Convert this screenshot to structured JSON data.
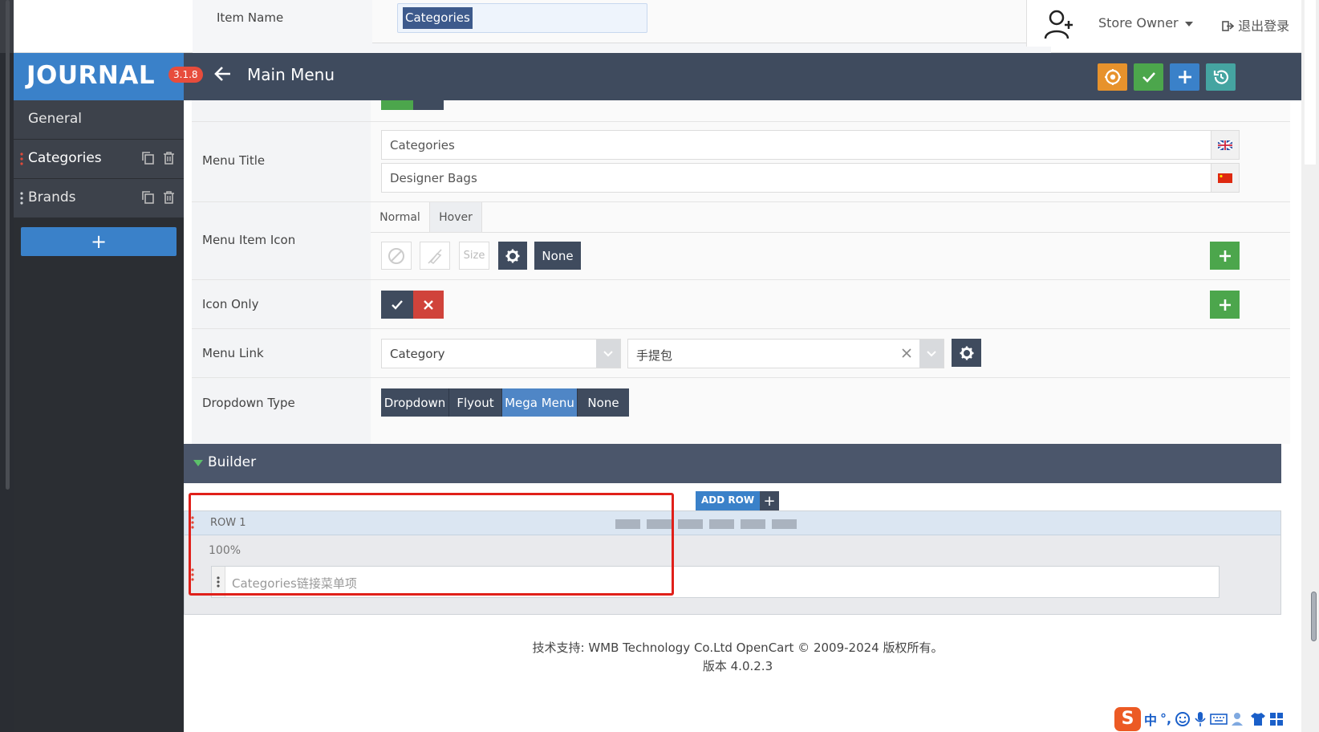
{
  "top": {
    "item_name_label": "Item Name",
    "item_name_value": "Categories",
    "user_label": "Store Owner",
    "logout_label": "退出登录"
  },
  "header": {
    "logo": "JOURNAL",
    "version": "3.1.8",
    "title": "Main Menu",
    "colors": {
      "bar": "#3f4b5e",
      "logo_bg": "#3a81c9",
      "reset": "#e7922c",
      "save": "#4ca64c",
      "add": "#3a81c9",
      "history": "#45a4a1"
    }
  },
  "sidebar": {
    "items": [
      {
        "label": "General"
      },
      {
        "label": "Categories"
      },
      {
        "label": "Brands"
      }
    ],
    "add_label": "+"
  },
  "form": {
    "menu_title": {
      "label": "Menu Title",
      "values": [
        "Categories",
        "Designer Bags"
      ]
    },
    "menu_item_icon": {
      "label": "Menu Item Icon",
      "tabs": [
        "Normal",
        "Hover"
      ],
      "size_placeholder": "Size",
      "none_label": "None"
    },
    "icon_only": {
      "label": "Icon Only"
    },
    "menu_link": {
      "label": "Menu Link",
      "type_value": "Category",
      "target_value": "手提包"
    },
    "dropdown_type": {
      "label": "Dropdown Type",
      "options": [
        "Dropdown",
        "Flyout",
        "Mega Menu",
        "None"
      ],
      "selected": "Mega Menu"
    }
  },
  "builder": {
    "title": "Builder",
    "add_row_label": "ADD ROW",
    "row_label": "ROW 1",
    "column_width": "100%",
    "column_item": "Categories链接菜单项"
  },
  "footer": {
    "line1": "技术支持: WMB Technology Co.Ltd OpenCart © 2009-2024 版权所有。",
    "line2": "版本 4.0.2.3"
  },
  "ime": {
    "lang": "中",
    "punct": "°,"
  }
}
